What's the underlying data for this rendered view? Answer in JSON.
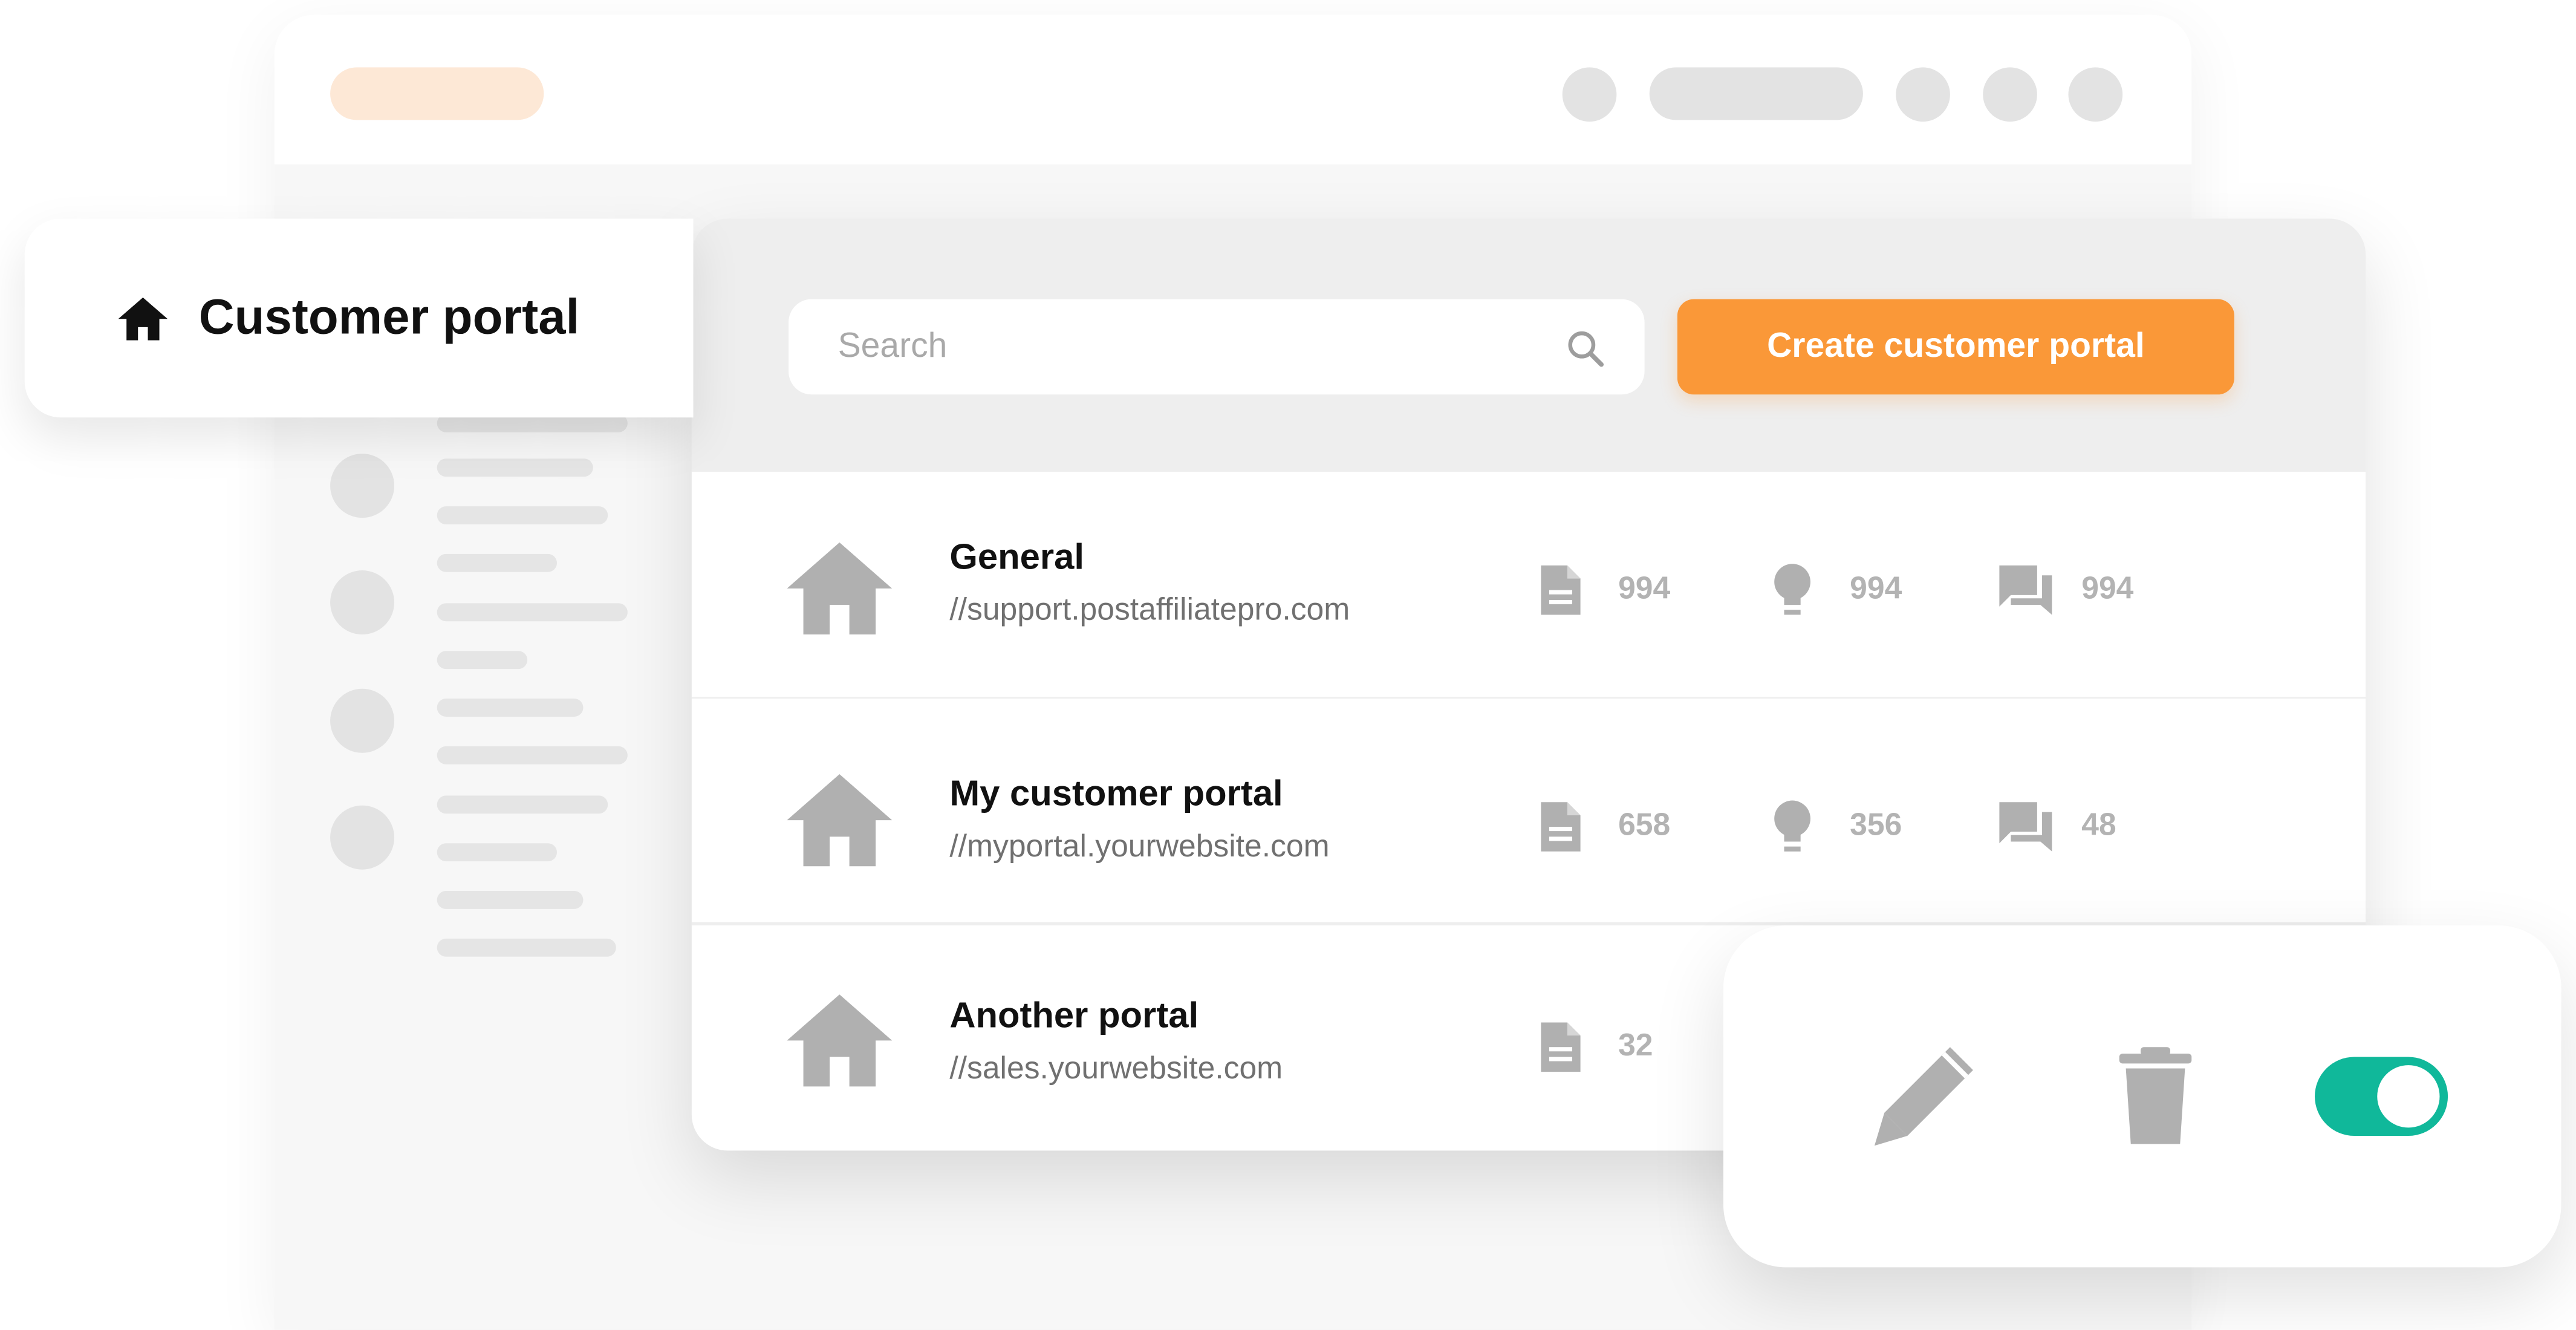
{
  "colors": {
    "accent": "#fa9838",
    "accent_light": "#fde8d6",
    "toggle_on": "#10b89a",
    "icon_gray": "#b0b0b0",
    "skeleton": "#e3e3e3"
  },
  "header": {
    "title": "Customer portal",
    "title_icon": "home-icon"
  },
  "toolbar": {
    "search_placeholder": "Search",
    "create_label": "Create customer portal"
  },
  "portals": [
    {
      "name": "General",
      "url": "//support.postaffiliatepro.com",
      "icon": "house-icon",
      "articles": "994",
      "ideas": "994",
      "discussions": "994"
    },
    {
      "name": "My customer portal",
      "url": "//myportal.yourwebsite.com",
      "icon": "house-icon",
      "articles": "658",
      "ideas": "356",
      "discussions": "48"
    },
    {
      "name": "Another portal",
      "url": "//sales.yourwebsite.com",
      "icon": "house-icon",
      "articles": "32"
    }
  ],
  "actions": {
    "edit_icon": "pencil-icon",
    "delete_icon": "trash-icon",
    "toggle_state": "on"
  }
}
